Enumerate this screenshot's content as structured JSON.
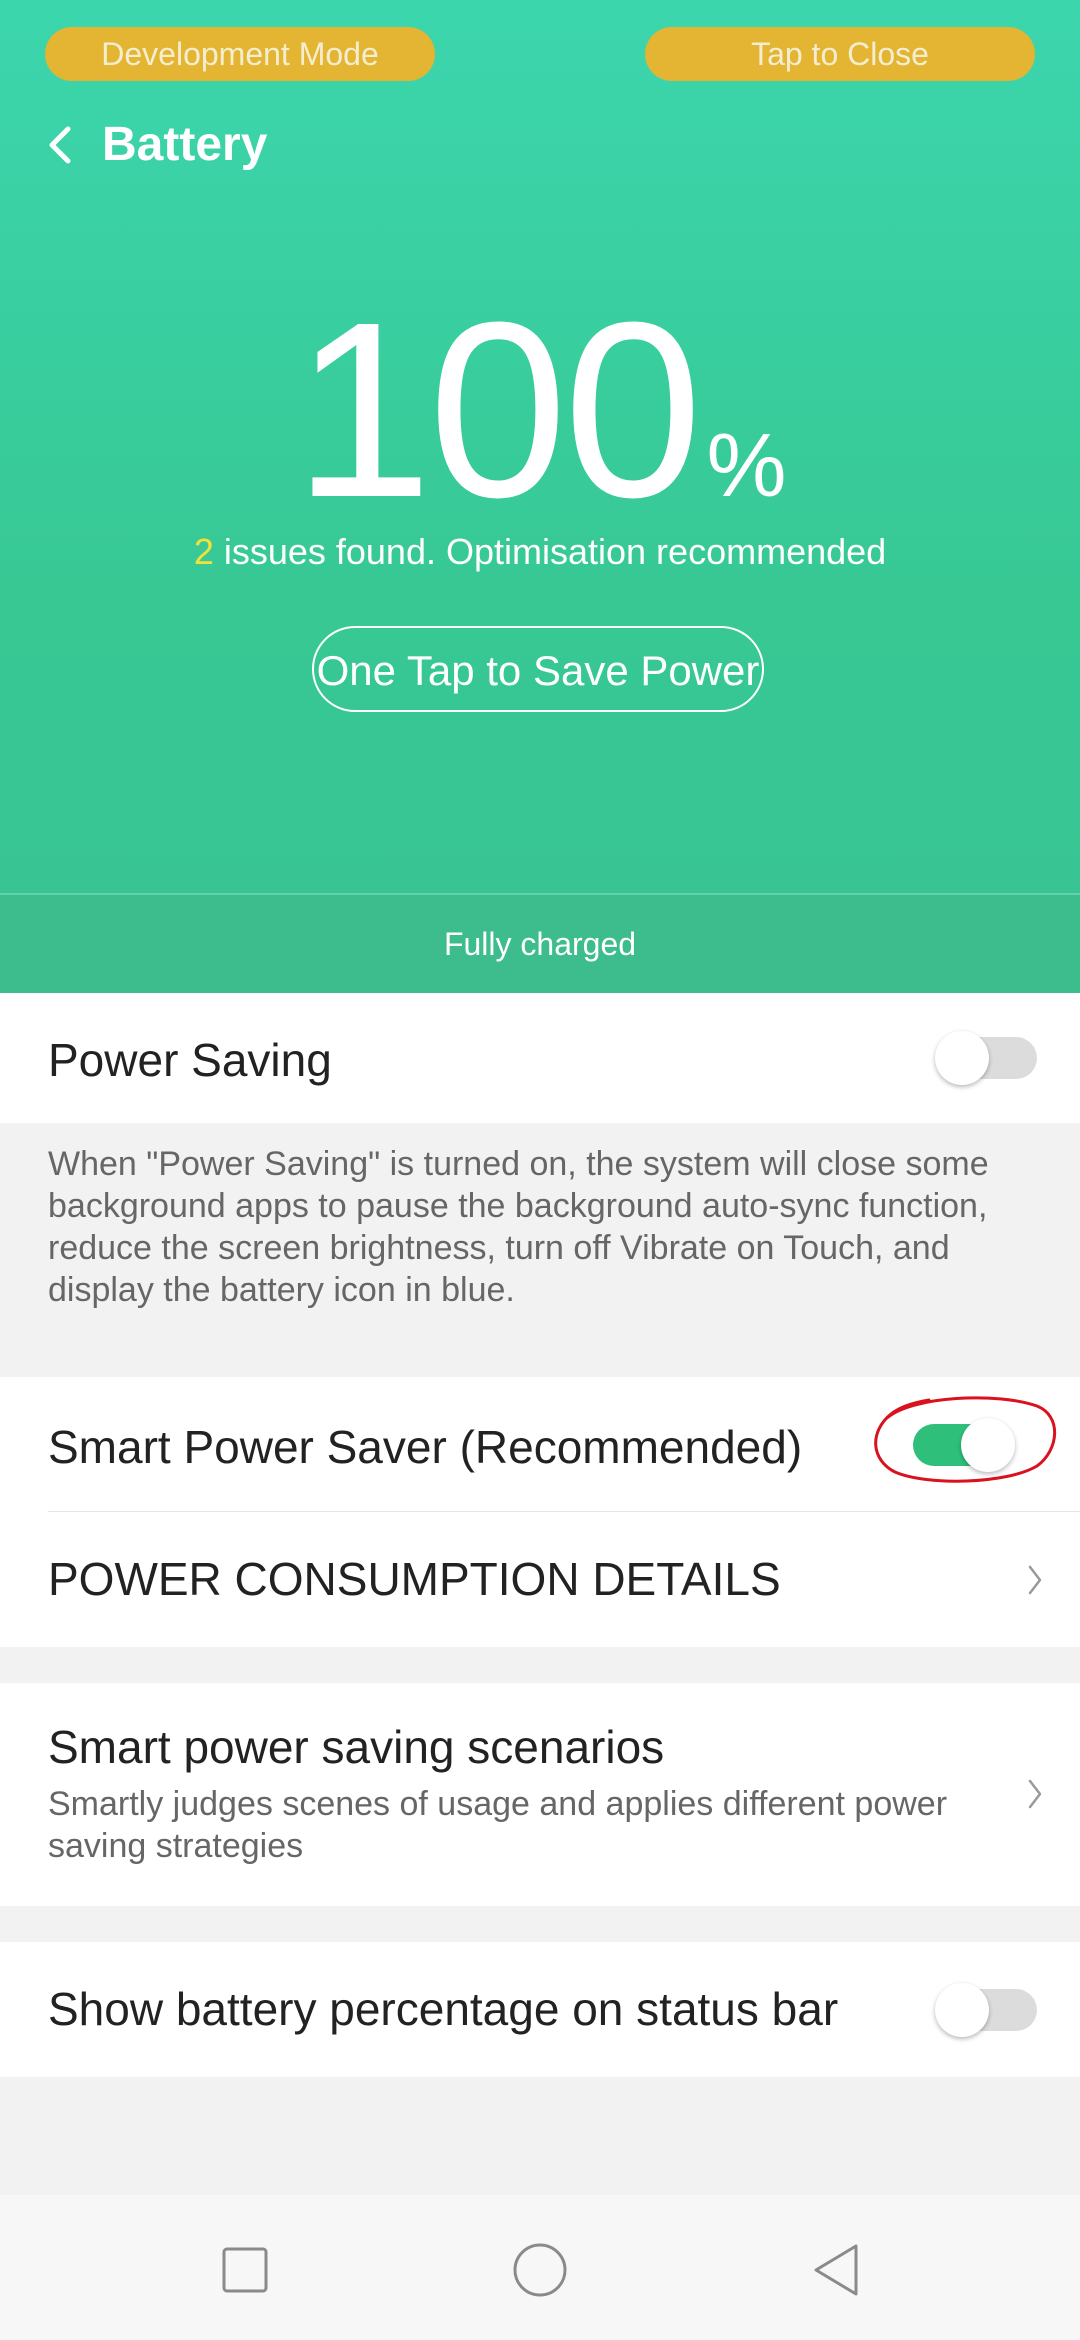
{
  "dev_banner": {
    "left_label": "Development Mode",
    "right_label": "Tap to Close"
  },
  "header": {
    "back_icon": "chevron-left-icon",
    "title": "Battery"
  },
  "battery": {
    "level": "100",
    "unit": "%",
    "issue_count": "2",
    "issue_text": " issues found. Optimisation recommended",
    "save_button": "One Tap to Save Power",
    "status": "Fully charged"
  },
  "power_saving": {
    "label": "Power Saving",
    "enabled": false,
    "description": "When \"Power Saving\" is turned on, the system will close some background apps to pause the background auto-sync function, reduce the screen brightness, turn off Vibrate on Touch, and display the battery icon in blue."
  },
  "smart_power_saver": {
    "label": "Smart Power Saver (Recommended)",
    "enabled": true
  },
  "consumption": {
    "label": "POWER CONSUMPTION DETAILS"
  },
  "scenarios": {
    "title": "Smart power saving scenarios",
    "description": "Smartly judges scenes of usage and applies different power saving strategies"
  },
  "status_bar_pct": {
    "label": "Show battery percentage on status bar",
    "enabled": false
  },
  "colors": {
    "header_green": "#3cd6ad",
    "banner_yellow": "#e3b532",
    "issue_count_yellow": "#f3e13a",
    "toggle_on": "#2ec07b",
    "annotation_red": "#d9121e"
  },
  "nav": {
    "icons": [
      "recents-square-icon",
      "home-circle-icon",
      "back-triangle-icon"
    ]
  }
}
